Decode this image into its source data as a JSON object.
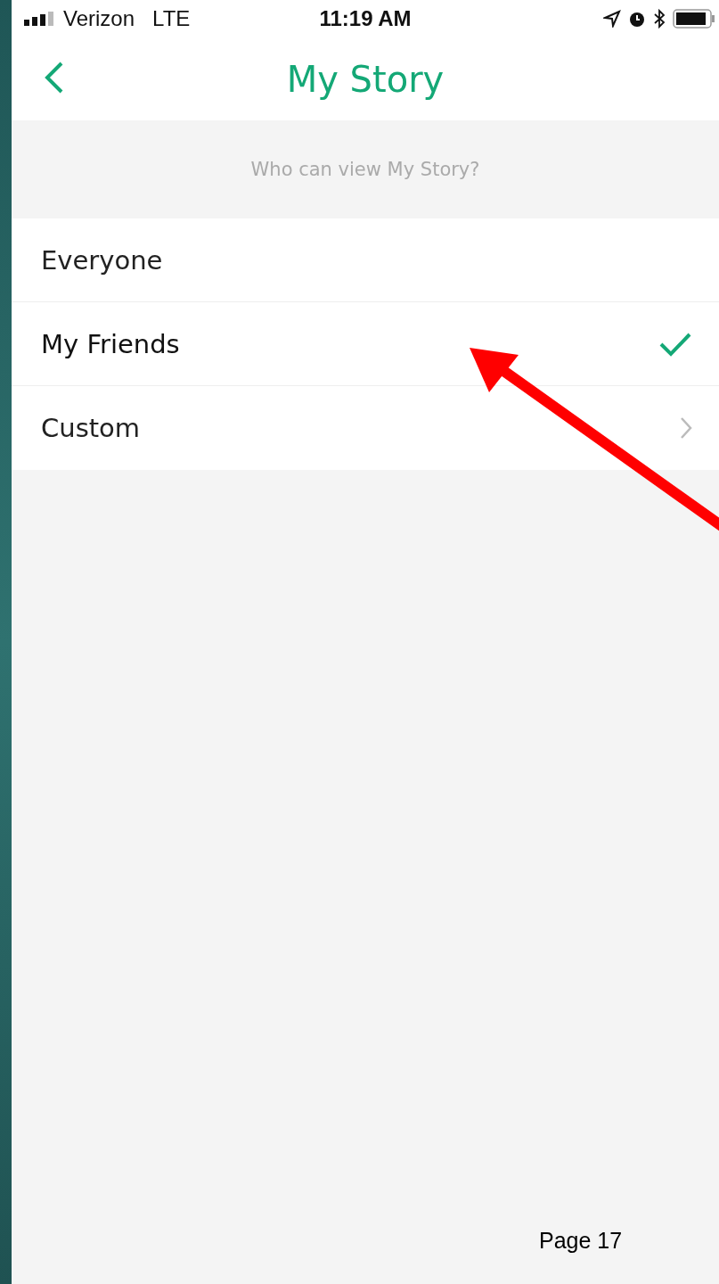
{
  "status_bar": {
    "carrier": "Verizon",
    "network": "LTE",
    "time": "11:19 AM"
  },
  "nav": {
    "title": "My Story"
  },
  "section_header": "Who can view My Story?",
  "options": [
    {
      "label": "Everyone",
      "kind": "choice",
      "selected": false
    },
    {
      "label": "My Friends",
      "kind": "choice",
      "selected": true
    },
    {
      "label": "Custom",
      "kind": "disclosure",
      "selected": false
    }
  ],
  "page_label": "Page 17"
}
